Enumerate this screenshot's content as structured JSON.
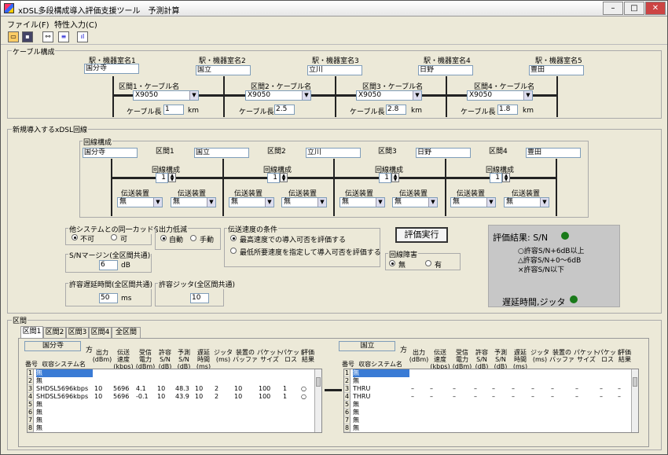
{
  "window": {
    "title": "xDSL多段構成導入評価支援ツール　予測計算"
  },
  "menu": {
    "file": "ファイル(F)",
    "input": "特性入力(C)"
  },
  "cable": {
    "section_title": "ケーブル構成",
    "stations": [
      {
        "label": "駅・機器室名1",
        "value": "国分寺"
      },
      {
        "label": "駅・機器室名2",
        "value": "国立"
      },
      {
        "label": "駅・機器室名3",
        "value": "立川"
      },
      {
        "label": "駅・機器室名4",
        "value": "日野"
      },
      {
        "label": "駅・機器室名5",
        "value": "豊田"
      }
    ],
    "segments": [
      {
        "label": "区間1・ケーブル名",
        "cable": "X9050",
        "length_label": "ケーブル長",
        "length": "1",
        "unit": "km"
      },
      {
        "label": "区間2・ケーブル名",
        "cable": "X9050",
        "length_label": "ケーブル長",
        "length": "2.5",
        "unit": "km"
      },
      {
        "label": "区間3・ケーブル名",
        "cable": "X9050",
        "length_label": "ケーブル長",
        "length": "2.8",
        "unit": "km"
      },
      {
        "label": "区間4・ケーブル名",
        "cable": "X9050",
        "length_label": "ケーブル長",
        "length": "1.8",
        "unit": "km"
      }
    ]
  },
  "circuit": {
    "section_title": "新規導入するxDSL回線",
    "sub_title": "回線構成",
    "stations": [
      "国分寺",
      "国立",
      "立川",
      "日野",
      "豊田"
    ],
    "segment_labels": [
      "区間1",
      "区間2",
      "区間3",
      "区間4"
    ],
    "config_label": "回線構成",
    "config_value": "1",
    "device_label": "伝送装置",
    "device_value": "無"
  },
  "crosstalk": {
    "title": "他システムとの同一カッド使用",
    "opt1": "不可",
    "opt2": "可"
  },
  "output": {
    "title": "出力低減",
    "opt1": "自動",
    "opt2": "手動"
  },
  "speed": {
    "title": "伝送速度の条件",
    "opt1": "最高速度での導入可否を評価する",
    "opt2": "最低所要速度を指定して導入可否を評価する"
  },
  "snmargin": {
    "title": "S/Nマージン(全区間共通)",
    "value": "6",
    "unit": "dB"
  },
  "delay": {
    "title": "許容遅延時間(全区間共通)",
    "value": "50",
    "unit": "ms"
  },
  "jitter": {
    "title": "許容ジッタ(全区間共通)",
    "value": "10"
  },
  "evaluate_button": "評価実行",
  "fault": {
    "title": "回線障害",
    "opt1": "無",
    "opt2": "有"
  },
  "result": {
    "title": "評価結果: S/N",
    "legend1": "○許容S/N+6dB以上",
    "legend2": "△許容S/N+0～6dB",
    "legend3": "×許容S/N以下",
    "delay_title": "遅延時間,ジッタ",
    "ok_color": "#1a7a1a"
  },
  "section": {
    "title": "区間",
    "tabs": [
      "区間1",
      "区間2",
      "区間3",
      "区間4",
      "全区間"
    ]
  },
  "left_table": {
    "station": "国分寺",
    "direction": "方",
    "headers": [
      "番号",
      "収容システム名",
      "出力 (dBm)",
      "伝送 速度 (kbps)",
      "受信 電力 (dBm)",
      "許容 S/N (dB)",
      "予測 S/N (dB)",
      "遅延 時間 (ms)",
      "ジッタ (ms)",
      "装置の バッファ",
      "パケット サイズ",
      "パケット ロス",
      "評価 結果"
    ],
    "rows": [
      {
        "num": "1",
        "name": "無",
        "out": "",
        "speed": "",
        "rx": "",
        "asn": "",
        "psn": "",
        "delay": "",
        "jitter": "",
        "buffer": "",
        "packet": "",
        "loss": "",
        "result": ""
      },
      {
        "num": "2",
        "name": "無",
        "out": "",
        "speed": "",
        "rx": "",
        "asn": "",
        "psn": "",
        "delay": "",
        "jitter": "",
        "buffer": "",
        "packet": "",
        "loss": "",
        "result": ""
      },
      {
        "num": "3",
        "name": "SHDSL5696kbps",
        "out": "10",
        "speed": "5696",
        "rx": "4.1",
        "asn": "10",
        "psn": "48.3",
        "delay": "10",
        "jitter": "2",
        "buffer": "10",
        "packet": "100",
        "loss": "1",
        "result": "○"
      },
      {
        "num": "4",
        "name": "SHDSL5696kbps",
        "out": "10",
        "speed": "5696",
        "rx": "-0.1",
        "asn": "10",
        "psn": "43.9",
        "delay": "10",
        "jitter": "2",
        "buffer": "10",
        "packet": "100",
        "loss": "1",
        "result": "○"
      },
      {
        "num": "5",
        "name": "無",
        "out": "",
        "speed": "",
        "rx": "",
        "asn": "",
        "psn": "",
        "delay": "",
        "jitter": "",
        "buffer": "",
        "packet": "",
        "loss": "",
        "result": ""
      },
      {
        "num": "6",
        "name": "無",
        "out": "",
        "speed": "",
        "rx": "",
        "asn": "",
        "psn": "",
        "delay": "",
        "jitter": "",
        "buffer": "",
        "packet": "",
        "loss": "",
        "result": ""
      },
      {
        "num": "7",
        "name": "無",
        "out": "",
        "speed": "",
        "rx": "",
        "asn": "",
        "psn": "",
        "delay": "",
        "jitter": "",
        "buffer": "",
        "packet": "",
        "loss": "",
        "result": ""
      },
      {
        "num": "8",
        "name": "無",
        "out": "",
        "speed": "",
        "rx": "",
        "asn": "",
        "psn": "",
        "delay": "",
        "jitter": "",
        "buffer": "",
        "packet": "",
        "loss": "",
        "result": ""
      }
    ]
  },
  "right_table": {
    "station": "国立",
    "direction": "方",
    "headers": [
      "番号",
      "収容システム名",
      "出力 (dBm)",
      "伝送 速度 (kbps)",
      "受信 電力 (dBm)",
      "許容 S/N (dB)",
      "予測 S/N (dB)",
      "遅延 時間 (ms)",
      "ジッタ (ms)",
      "装置の バッファ",
      "パケット サイズ",
      "パケット ロス",
      "評価 結果"
    ],
    "rows": [
      {
        "num": "1",
        "name": "無",
        "out": "",
        "speed": "",
        "rx": "",
        "asn": "",
        "psn": "",
        "delay": "",
        "jitter": "",
        "buffer": "",
        "packet": "",
        "loss": "",
        "result": ""
      },
      {
        "num": "2",
        "name": "無",
        "out": "",
        "speed": "",
        "rx": "",
        "asn": "",
        "psn": "",
        "delay": "",
        "jitter": "",
        "buffer": "",
        "packet": "",
        "loss": "",
        "result": ""
      },
      {
        "num": "3",
        "name": "THRU",
        "out": "–",
        "speed": "–",
        "rx": "–",
        "asn": "–",
        "psn": "–",
        "delay": "–",
        "jitter": "–",
        "buffer": "–",
        "packet": "–",
        "loss": "–",
        "result": "–"
      },
      {
        "num": "4",
        "name": "THRU",
        "out": "–",
        "speed": "–",
        "rx": "–",
        "asn": "–",
        "psn": "–",
        "delay": "–",
        "jitter": "–",
        "buffer": "–",
        "packet": "–",
        "loss": "–",
        "result": "–"
      },
      {
        "num": "5",
        "name": "無",
        "out": "",
        "speed": "",
        "rx": "",
        "asn": "",
        "psn": "",
        "delay": "",
        "jitter": "",
        "buffer": "",
        "packet": "",
        "loss": "",
        "result": ""
      },
      {
        "num": "6",
        "name": "無",
        "out": "",
        "speed": "",
        "rx": "",
        "asn": "",
        "psn": "",
        "delay": "",
        "jitter": "",
        "buffer": "",
        "packet": "",
        "loss": "",
        "result": ""
      },
      {
        "num": "7",
        "name": "無",
        "out": "",
        "speed": "",
        "rx": "",
        "asn": "",
        "psn": "",
        "delay": "",
        "jitter": "",
        "buffer": "",
        "packet": "",
        "loss": "",
        "result": ""
      },
      {
        "num": "8",
        "name": "無",
        "out": "",
        "speed": "",
        "rx": "",
        "asn": "",
        "psn": "",
        "delay": "",
        "jitter": "",
        "buffer": "",
        "packet": "",
        "loss": "",
        "result": ""
      }
    ]
  }
}
